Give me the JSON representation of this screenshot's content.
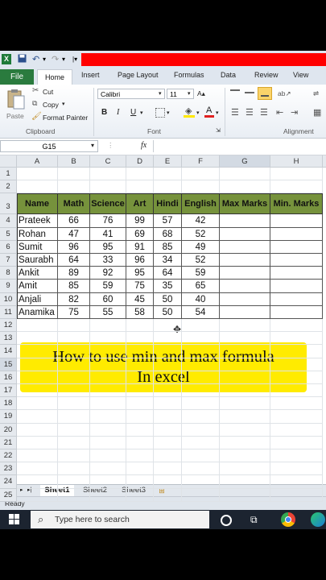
{
  "quick_access": {
    "dropdown_glyph": "▾"
  },
  "ribbon_tabs": [
    "File",
    "Home",
    "Insert",
    "Page Layout",
    "Formulas",
    "Data",
    "Review",
    "View"
  ],
  "clipboard": {
    "paste": "Paste",
    "cut": "Cut",
    "copy": "Copy",
    "format_painter": "Format Painter",
    "group": "Clipboard"
  },
  "font": {
    "name": "Calibri",
    "size": "11",
    "bold": "B",
    "italic": "I",
    "underline": "U",
    "color_letter": "A",
    "group": "Font",
    "color_red": "#e02020",
    "fill_yellow": "#ffe800"
  },
  "alignment": {
    "group": "Alignment"
  },
  "formula_bar": {
    "name_box": "G15",
    "fx": "fx",
    "formula": ""
  },
  "columns": [
    "A",
    "B",
    "C",
    "D",
    "E",
    "F",
    "G",
    "H"
  ],
  "rows": [
    "1",
    "2",
    "3",
    "4",
    "5",
    "6",
    "7",
    "8",
    "9",
    "10",
    "11",
    "12",
    "13",
    "14",
    "15",
    "16",
    "17",
    "18",
    "19",
    "20",
    "21",
    "22",
    "23",
    "24",
    "25"
  ],
  "table": {
    "headers": [
      "Name",
      "Math",
      "Science",
      "Art",
      "Hindi",
      "English",
      "Max Marks",
      "Min. Marks"
    ],
    "rows": [
      [
        "Prateek",
        "66",
        "76",
        "99",
        "57",
        "42",
        "",
        ""
      ],
      [
        "Rohan",
        "47",
        "41",
        "69",
        "68",
        "52",
        "",
        ""
      ],
      [
        "Sumit",
        "96",
        "95",
        "91",
        "85",
        "49",
        "",
        ""
      ],
      [
        "Saurabh",
        "64",
        "33",
        "96",
        "34",
        "52",
        "",
        ""
      ],
      [
        "Ankit",
        "89",
        "92",
        "95",
        "64",
        "59",
        "",
        ""
      ],
      [
        "Amit",
        "85",
        "59",
        "75",
        "35",
        "65",
        "",
        ""
      ],
      [
        "Anjali",
        "82",
        "60",
        "45",
        "50",
        "40",
        "",
        ""
      ],
      [
        "Anamika",
        "75",
        "55",
        "58",
        "50",
        "54",
        "",
        ""
      ]
    ],
    "header_color": "#76923c"
  },
  "banner": {
    "line1": "How to use min and max formula",
    "line2": "In excel",
    "color": "#ffeb00"
  },
  "sheets": [
    "Sheet1",
    "Sheet2",
    "Sheet3"
  ],
  "status": "Ready",
  "taskbar": {
    "search_placeholder": "Type here to search"
  }
}
